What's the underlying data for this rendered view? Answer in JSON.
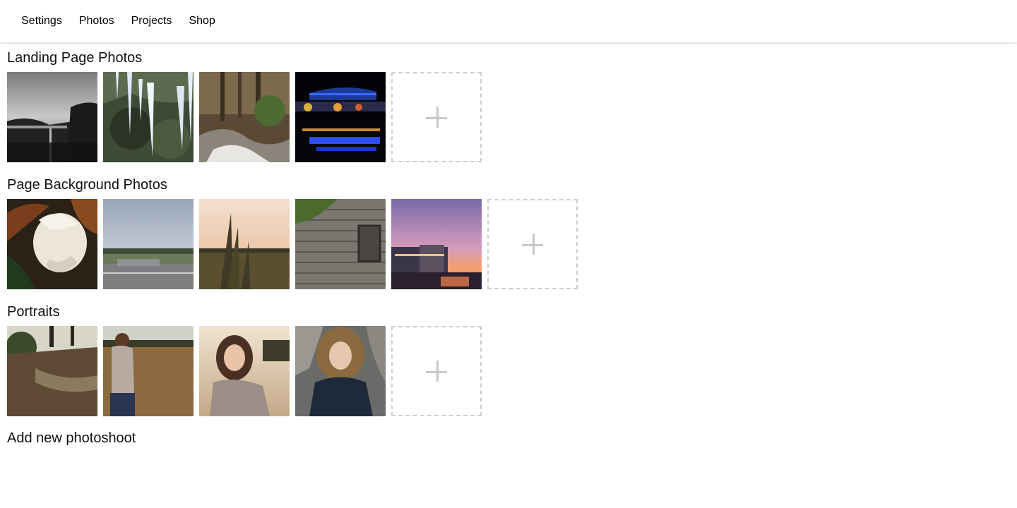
{
  "nav": {
    "items": [
      "Settings",
      "Photos",
      "Projects",
      "Shop"
    ]
  },
  "sections": [
    {
      "title": "Landing Page Photos",
      "photos": [
        "bridge-bw",
        "icicles-rock",
        "forest-creek",
        "night-building-blue"
      ]
    },
    {
      "title": "Page Background Photos",
      "photos": [
        "magnolia-flower",
        "cloudy-road",
        "grass-sunset",
        "wooden-barn",
        "campus-sunset"
      ]
    },
    {
      "title": "Portraits",
      "photos": [
        "park-path",
        "woman-field",
        "woman-road",
        "woman-fur-hood"
      ]
    }
  ],
  "add_photoshoot_label": "Add new photoshoot",
  "colors": {
    "add_tile_border": "#cfcfcf",
    "plus": "#c8c8c8"
  }
}
